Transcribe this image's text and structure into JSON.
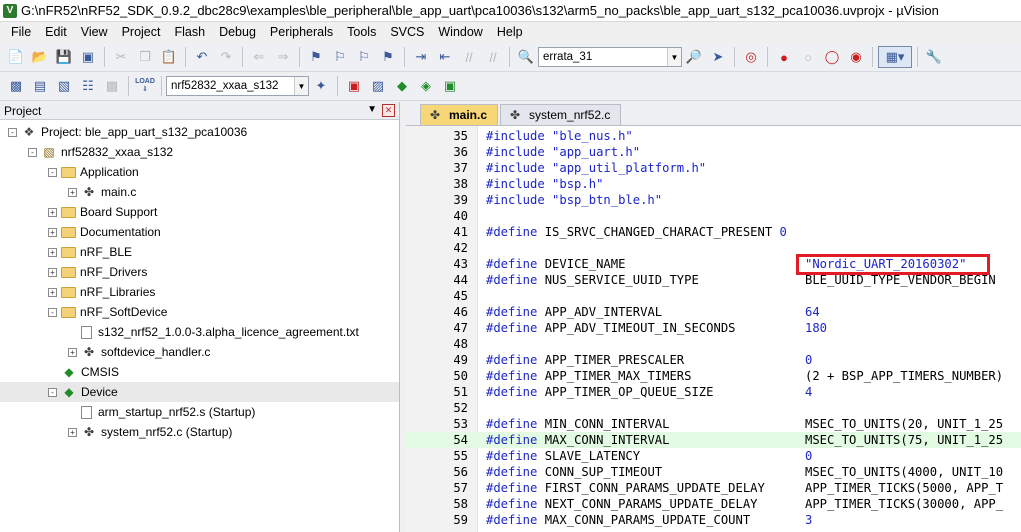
{
  "window": {
    "title": "G:\\nFR52\\nRF52_SDK_0.9.2_dbc28c9\\examples\\ble_peripheral\\ble_app_uart\\pca10036\\s132\\arm5_no_packs\\ble_app_uart_s132_pca10036.uvprojx - µVision",
    "icon": "V"
  },
  "menu": [
    "File",
    "Edit",
    "View",
    "Project",
    "Flash",
    "Debug",
    "Peripherals",
    "Tools",
    "SVCS",
    "Window",
    "Help"
  ],
  "toolbar": {
    "find_combo_value": "errata_31",
    "target_combo_value": "nrf52832_xxaa_s132",
    "load_label": "LOAD"
  },
  "project_panel": {
    "title": "Project",
    "tree": [
      {
        "label": "Project: ble_app_uart_s132_pca10036",
        "icon": "project-icon",
        "level": 0,
        "expander": "-"
      },
      {
        "label": "nrf52832_xxaa_s132",
        "icon": "target-icon",
        "level": 1,
        "expander": "-"
      },
      {
        "label": "Application",
        "icon": "folder-icon",
        "level": 2,
        "expander": "-"
      },
      {
        "label": "main.c",
        "icon": "c-file-icon",
        "level": 3,
        "expander": "+"
      },
      {
        "label": "Board Support",
        "icon": "folder-icon",
        "level": 2,
        "expander": "+"
      },
      {
        "label": "Documentation",
        "icon": "folder-icon",
        "level": 2,
        "expander": "+"
      },
      {
        "label": "nRF_BLE",
        "icon": "folder-icon",
        "level": 2,
        "expander": "+"
      },
      {
        "label": "nRF_Drivers",
        "icon": "folder-icon",
        "level": 2,
        "expander": "+"
      },
      {
        "label": "nRF_Libraries",
        "icon": "folder-icon",
        "level": 2,
        "expander": "+"
      },
      {
        "label": "nRF_SoftDevice",
        "icon": "folder-icon",
        "level": 2,
        "expander": "-"
      },
      {
        "label": "s132_nrf52_1.0.0-3.alpha_licence_agreement.txt",
        "icon": "text-file-icon",
        "level": 3,
        "expander": ""
      },
      {
        "label": "softdevice_handler.c",
        "icon": "c-file-icon",
        "level": 3,
        "expander": "+"
      },
      {
        "label": "CMSIS",
        "icon": "component-icon",
        "level": 2,
        "expander": ""
      },
      {
        "label": "Device",
        "icon": "component-icon",
        "level": 2,
        "expander": "-"
      },
      {
        "label": "arm_startup_nrf52.s (Startup)",
        "icon": "text-file-icon",
        "level": 3,
        "expander": ""
      },
      {
        "label": "system_nrf52.c (Startup)",
        "icon": "c-file-icon",
        "level": 3,
        "expander": "+"
      }
    ]
  },
  "editor": {
    "tabs": [
      {
        "label": "main.c",
        "active": true
      },
      {
        "label": "system_nrf52.c",
        "active": false
      }
    ],
    "lines": [
      {
        "n": "35",
        "kw": "#include",
        "name": "",
        "val": "\"ble_nus.h\"",
        "inline": true
      },
      {
        "n": "36",
        "kw": "#include",
        "name": "",
        "val": "\"app_uart.h\"",
        "inline": true
      },
      {
        "n": "37",
        "kw": "#include",
        "name": "",
        "val": "\"app_util_platform.h\"",
        "inline": true
      },
      {
        "n": "38",
        "kw": "#include",
        "name": "",
        "val": "\"bsp.h\"",
        "inline": true
      },
      {
        "n": "39",
        "kw": "#include",
        "name": "",
        "val": "\"bsp_btn_ble.h\"",
        "inline": true
      },
      {
        "n": "40",
        "kw": "",
        "name": "",
        "val": "",
        "inline": true
      },
      {
        "n": "41",
        "kw": "#define",
        "name": "IS_SRVC_CHANGED_CHARACT_PRESENT",
        "val": "0",
        "inline": true
      },
      {
        "n": "42",
        "kw": "",
        "name": "",
        "val": "",
        "inline": true
      },
      {
        "n": "43",
        "kw": "#define",
        "name": "DEVICE_NAME",
        "val": "\"Nordic_UART_20160302\"",
        "inline": false
      },
      {
        "n": "44",
        "kw": "#define",
        "name": "NUS_SERVICE_UUID_TYPE",
        "val": "BLE_UUID_TYPE_VENDOR_BEGIN",
        "inline": false
      },
      {
        "n": "45",
        "kw": "",
        "name": "",
        "val": "",
        "inline": true
      },
      {
        "n": "46",
        "kw": "#define",
        "name": "APP_ADV_INTERVAL",
        "val": "64",
        "inline": false
      },
      {
        "n": "47",
        "kw": "#define",
        "name": "APP_ADV_TIMEOUT_IN_SECONDS",
        "val": "180",
        "inline": false
      },
      {
        "n": "48",
        "kw": "",
        "name": "",
        "val": "",
        "inline": true
      },
      {
        "n": "49",
        "kw": "#define",
        "name": "APP_TIMER_PRESCALER",
        "val": "0",
        "inline": false
      },
      {
        "n": "50",
        "kw": "#define",
        "name": "APP_TIMER_MAX_TIMERS",
        "val": "(2 + BSP_APP_TIMERS_NUMBER)",
        "inline": false
      },
      {
        "n": "51",
        "kw": "#define",
        "name": "APP_TIMER_OP_QUEUE_SIZE",
        "val": "4",
        "inline": false
      },
      {
        "n": "52",
        "kw": "",
        "name": "",
        "val": "",
        "inline": true
      },
      {
        "n": "53",
        "kw": "#define",
        "name": "MIN_CONN_INTERVAL",
        "val": "MSEC_TO_UNITS(20, UNIT_1_25",
        "inline": false
      },
      {
        "n": "54",
        "kw": "#define",
        "name": "MAX_CONN_INTERVAL",
        "val": "MSEC_TO_UNITS(75, UNIT_1_25",
        "inline": false
      },
      {
        "n": "55",
        "kw": "#define",
        "name": "SLAVE_LATENCY",
        "val": "0",
        "inline": false
      },
      {
        "n": "56",
        "kw": "#define",
        "name": "CONN_SUP_TIMEOUT",
        "val": "MSEC_TO_UNITS(4000, UNIT_10",
        "inline": false
      },
      {
        "n": "57",
        "kw": "#define",
        "name": "FIRST_CONN_PARAMS_UPDATE_DELAY",
        "val": "APP_TIMER_TICKS(5000, APP_T",
        "inline": false
      },
      {
        "n": "58",
        "kw": "#define",
        "name": "NEXT_CONN_PARAMS_UPDATE_DELAY",
        "val": "APP_TIMER_TICKS(30000, APP_",
        "inline": false
      },
      {
        "n": "59",
        "kw": "#define",
        "name": "MAX_CONN_PARAMS_UPDATE_COUNT",
        "val": "3",
        "inline": false
      }
    ],
    "highlighted_line": "54"
  }
}
